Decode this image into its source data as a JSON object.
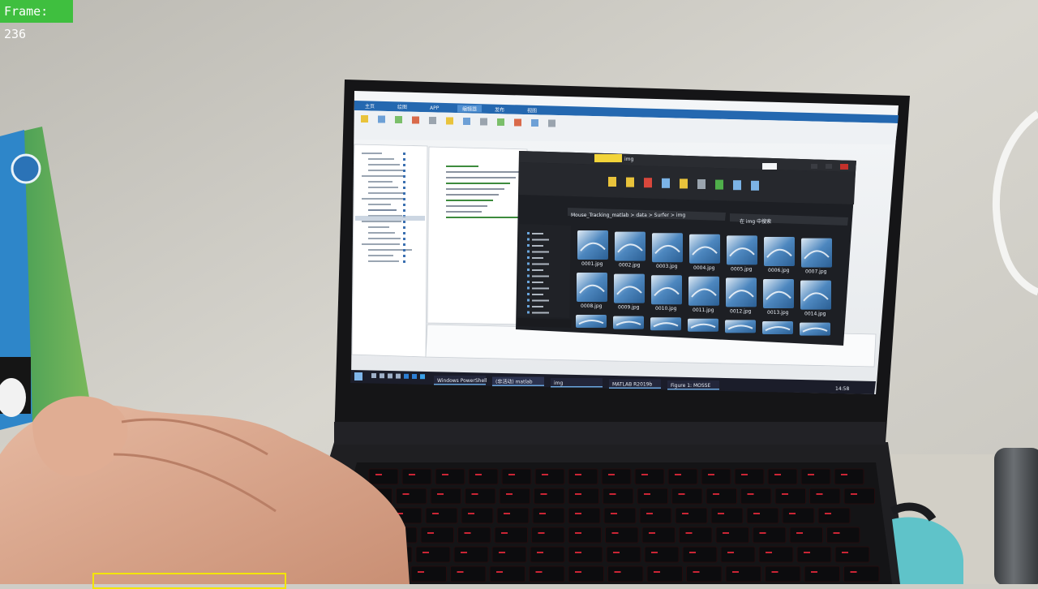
{
  "overlay": {
    "frame_label": "Frame: 236",
    "box_color": "#f3e500",
    "badge_color": "#3fbf3f"
  },
  "laptop_screen": {
    "matlab_tabs": [
      "主页",
      "绘图",
      "APP",
      "编辑器",
      "发布",
      "视图"
    ],
    "explorer_title": "img",
    "explorer_path": "Mouse_Tracking_matlab > data > Surfer > img",
    "search_placeholder": "在 img 中搜索",
    "thumbnails": [
      "0001.jpg",
      "0002.jpg",
      "0003.jpg",
      "0004.jpg",
      "0005.jpg",
      "0006.jpg",
      "0007.jpg",
      "0008.jpg",
      "0009.jpg",
      "0010.jpg",
      "0011.jpg",
      "0012.jpg",
      "0013.jpg",
      "0014.jpg"
    ],
    "taskbar_items": [
      "Windows PowerShell",
      "(非活动) matlab",
      "img",
      "MATLAB R2019b",
      "Figure 1: MOSSE"
    ],
    "clock": "14:58"
  },
  "objects": [
    "hand-holding-card",
    "laptop",
    "water-bottle",
    "white-cable",
    "teal-device"
  ]
}
